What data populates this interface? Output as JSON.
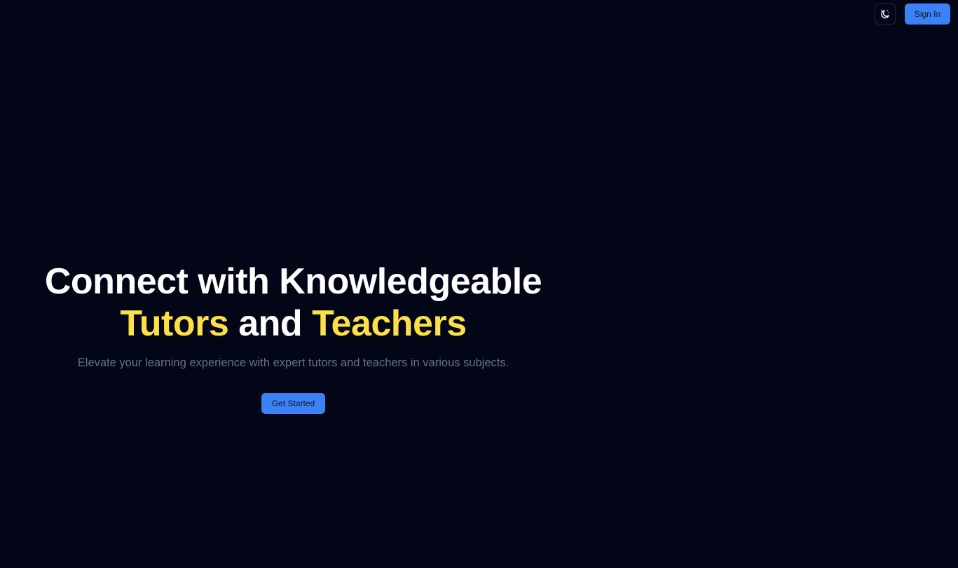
{
  "header": {
    "theme_toggle_icon": "moon-stars-icon",
    "sign_in_label": "Sign In"
  },
  "hero": {
    "headline_part1": "Connect with Knowledgeable",
    "headline_accent1": "Tutors",
    "headline_and": "and",
    "headline_accent2": "Teachers",
    "subtitle": "Elevate your learning experience with expert tutors and teachers in various subjects.",
    "cta_label": "Get Started"
  },
  "colors": {
    "background": "#020617",
    "accent_yellow": "#fde047",
    "primary_blue": "#3b82f6",
    "muted_text": "#64748b"
  }
}
